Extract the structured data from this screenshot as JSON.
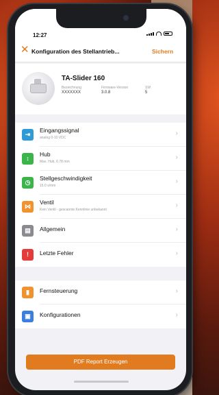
{
  "status_bar": {
    "time": "12:27"
  },
  "nav": {
    "close_icon": "close-x",
    "title": "Konfiguration des Stellantrieb...",
    "save_label": "Sichern"
  },
  "device": {
    "name": "TA-Slider 160",
    "designation_label": "Bezeichnung",
    "designation_value": "XXXXXXX",
    "firmware_label": "Firmware-Version",
    "firmware_value": "3.0.8",
    "sw_label": "SW",
    "sw_value": "5"
  },
  "menu_sections": [
    {
      "items": [
        {
          "icon": "input-signal-icon",
          "color": "#2f9bd6",
          "label": "Eingangssignal",
          "sub": "analog 0-10 VDC"
        },
        {
          "icon": "stroke-icon",
          "color": "#3bb54a",
          "label": "Hub",
          "sub": "Max. Hub, 6.78 mm"
        },
        {
          "icon": "speed-icon",
          "color": "#3bb54a",
          "label": "Stellgeschwindigkeit",
          "sub": "15.0 s/mm"
        },
        {
          "icon": "valve-icon",
          "color": "#f0932f",
          "label": "Ventil",
          "sub": "Kein Ventil - gescannte Kennlinie unbekannt"
        },
        {
          "icon": "general-icon",
          "color": "#8a8a8f",
          "label": "Allgemein",
          "sub": ""
        },
        {
          "icon": "error-icon",
          "color": "#e43b3b",
          "label": "Letzte Fehler",
          "sub": ""
        }
      ]
    },
    {
      "items": [
        {
          "icon": "remote-control-icon",
          "color": "#f0932f",
          "label": "Fernsteuerung",
          "sub": ""
        },
        {
          "icon": "configurations-icon",
          "color": "#3a7fe0",
          "label": "Konfigurationen",
          "sub": ""
        }
      ]
    }
  ],
  "footer": {
    "report_button": "PDF Report Erzeugen"
  }
}
